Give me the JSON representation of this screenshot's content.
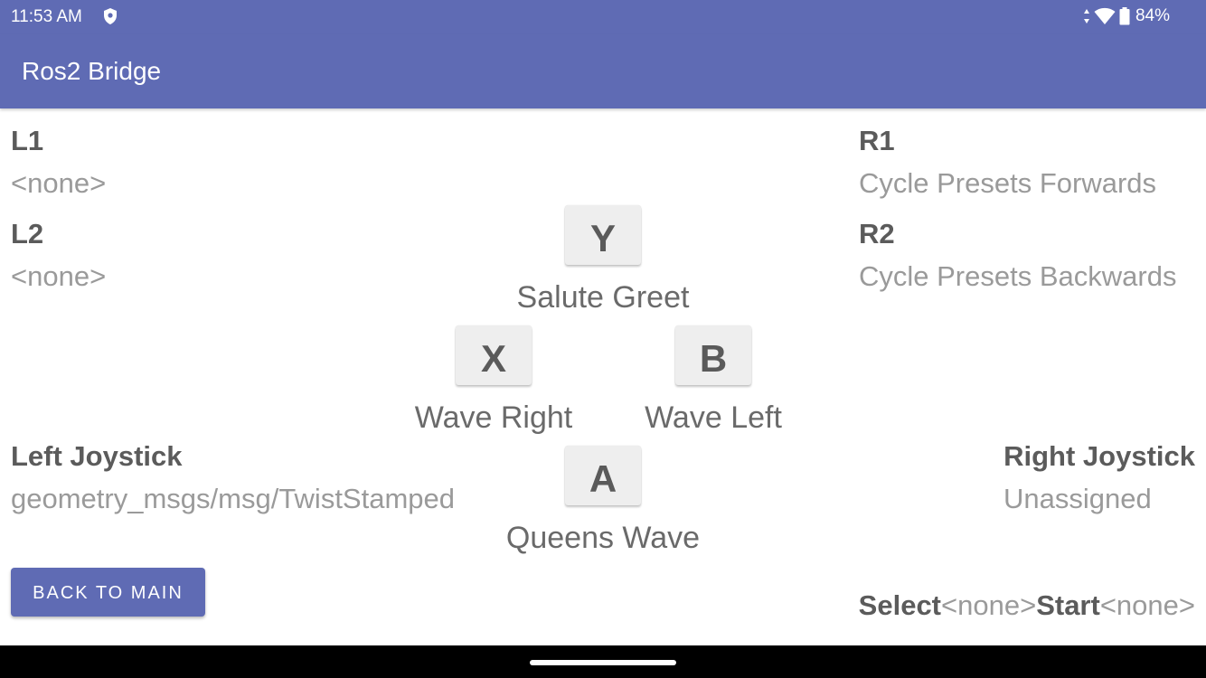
{
  "status_bar": {
    "time": "11:53 AM",
    "battery_percent": "84%",
    "icons": [
      "shield-icon",
      "signal-arrows-icon",
      "wifi-icon",
      "battery-icon"
    ]
  },
  "app_bar": {
    "title": "Ros2 Bridge"
  },
  "left_buttons": {
    "l1": {
      "name": "L1",
      "value": "<none>"
    },
    "l2": {
      "name": "L2",
      "value": "<none>"
    }
  },
  "right_buttons": {
    "r1": {
      "name": "R1",
      "value": "Cycle Presets Forwards"
    },
    "r2": {
      "name": "R2",
      "value": "Cycle Presets Backwards"
    }
  },
  "face_buttons": {
    "y": {
      "key": "Y",
      "action": "Salute Greet"
    },
    "x": {
      "key": "X",
      "action": "Wave Right"
    },
    "b": {
      "key": "B",
      "action": "Wave Left"
    },
    "a": {
      "key": "A",
      "action": "Queens Wave"
    }
  },
  "joysticks": {
    "left": {
      "name": "Left Joystick",
      "value": "geometry_msgs/msg/TwistStamped"
    },
    "right": {
      "name": "Right Joystick",
      "value": "Unassigned"
    }
  },
  "back_button": {
    "label": "BACK TO MAIN"
  },
  "select_start": {
    "select_label": "Select",
    "select_value": "<none>",
    "start_label": "Start",
    "start_value": "<none>"
  },
  "colors": {
    "primary": "#5f6bb4",
    "heading_text": "#5b5b5b",
    "value_text": "#9a9a9a",
    "key_background": "#eeeeee"
  }
}
